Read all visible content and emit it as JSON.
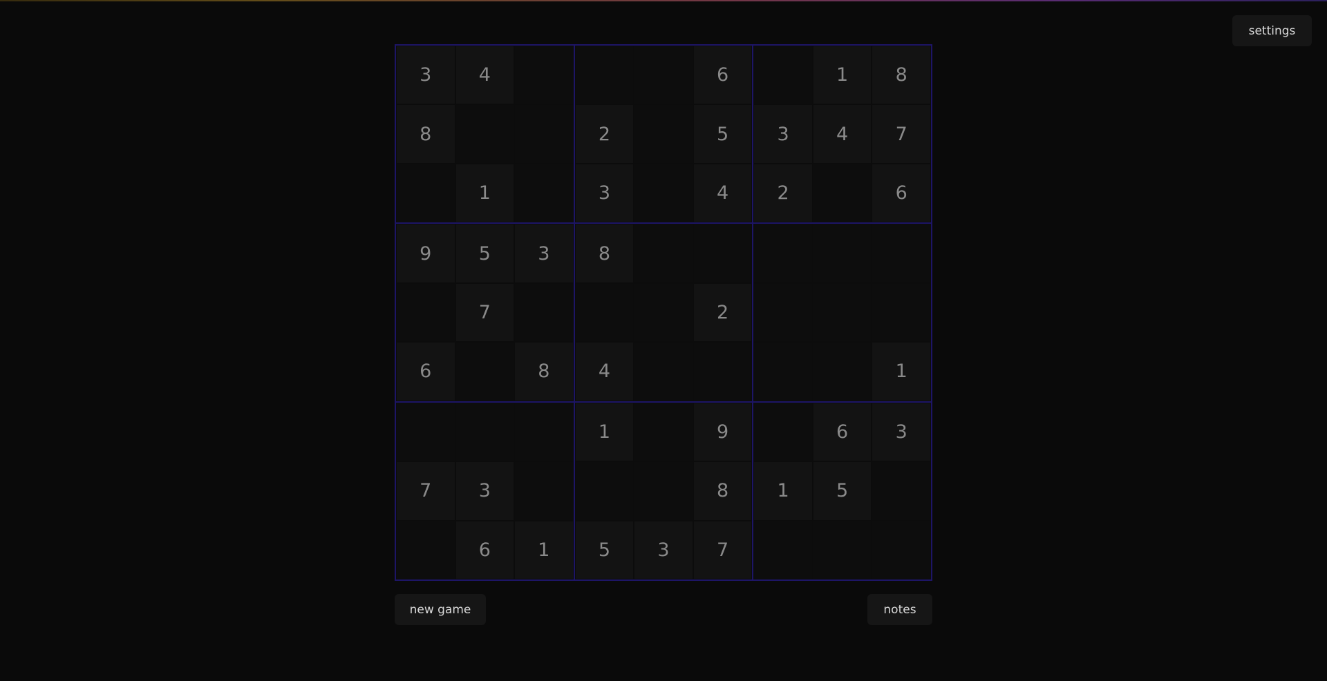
{
  "header": {
    "settings_label": "settings"
  },
  "footer": {
    "new_game_label": "new game",
    "notes_label": "notes"
  },
  "board": {
    "rows": [
      [
        "3",
        "4",
        "",
        "",
        "",
        "6",
        "",
        "1",
        "8"
      ],
      [
        "8",
        "",
        "",
        "2",
        "",
        "5",
        "3",
        "4",
        "7"
      ],
      [
        "",
        "1",
        "",
        "3",
        "",
        "4",
        "2",
        "",
        "6"
      ],
      [
        "9",
        "5",
        "3",
        "8",
        "",
        "",
        "",
        "",
        ""
      ],
      [
        "",
        "7",
        "",
        "",
        "",
        "2",
        "",
        "",
        ""
      ],
      [
        "6",
        "",
        "8",
        "4",
        "",
        "",
        "",
        "",
        "1"
      ],
      [
        "",
        "",
        "",
        "1",
        "",
        "9",
        "",
        "6",
        "3"
      ],
      [
        "7",
        "3",
        "",
        "",
        "",
        "8",
        "1",
        "5",
        ""
      ],
      [
        "",
        "6",
        "1",
        "5",
        "3",
        "7",
        "",
        "",
        ""
      ]
    ]
  }
}
